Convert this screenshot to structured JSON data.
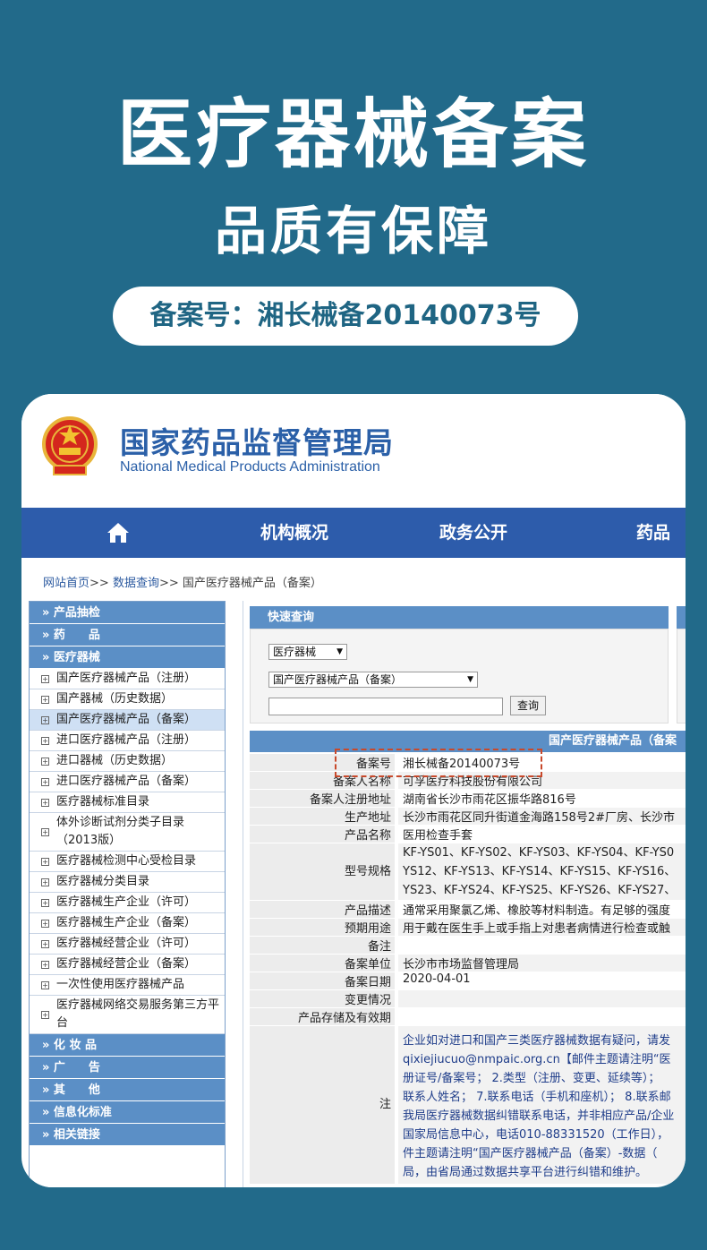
{
  "banner": {
    "title": "医疗器械备案",
    "subtitle": "品质有保障",
    "record_number": "备案号：湘长械备20140073号"
  },
  "site": {
    "org_cn": "国家药品监督管理局",
    "org_en": "National Medical Products Administration"
  },
  "nav": {
    "items": [
      "机构概况",
      "政务公开",
      "药品"
    ]
  },
  "breadcrumb": {
    "home": "网站首页",
    "sep": ">>",
    "query": "数据查询",
    "current": "国产医疗器械产品（备案）"
  },
  "sidebar": {
    "sections_top": [
      "» 产品抽检",
      "» 药　　品",
      "» 医疗器械"
    ],
    "items": [
      "国产医疗器械产品（注册）",
      "国产器械（历史数据）",
      "国产医疗器械产品（备案）",
      "进口医疗器械产品（注册）",
      "进口器械（历史数据）",
      "进口医疗器械产品（备案）",
      "医疗器械标准目录",
      "体外诊断试剂分类子目录（2013版）",
      "医疗器械检测中心受检目录",
      "医疗器械分类目录",
      "医疗器械生产企业（许可）",
      "医疗器械生产企业（备案）",
      "医疗器械经营企业（许可）",
      "医疗器械经营企业（备案）",
      "一次性使用医疗器械产品",
      "医疗器械网络交易服务第三方平台"
    ],
    "sections_bottom": [
      "» 化 妆 品",
      "» 广　　告",
      "» 其　　他",
      "» 信息化标准",
      "» 相关链接"
    ]
  },
  "quick_search": {
    "header": "快速查询",
    "select1": "医疗器械",
    "select2": "国产医疗器械产品（备案）",
    "button": "查询"
  },
  "result": {
    "header": "国产医疗器械产品（备案",
    "rows": [
      {
        "label": "备案号",
        "value": "湘长械备20140073号"
      },
      {
        "label": "备案人名称",
        "value": "可孚医疗科技股份有限公司"
      },
      {
        "label": "备案人注册地址",
        "value": "湖南省长沙市雨花区振华路816号"
      },
      {
        "label": "生产地址",
        "value": "长沙市雨花区同升街道金海路158号2#厂房、长沙市"
      },
      {
        "label": "产品名称",
        "value": "医用检查手套"
      },
      {
        "label": "型号规格",
        "value_lines": [
          "KF-YS01、KF-YS02、KF-YS03、KF-YS04、KF-YS0",
          "YS12、KF-YS13、KF-YS14、KF-YS15、KF-YS16、",
          "YS23、KF-YS24、KF-YS25、KF-YS26、KF-YS27、"
        ]
      },
      {
        "label": "产品描述",
        "value": "通常采用聚氯乙烯、橡胶等材料制造。有足够的强度"
      },
      {
        "label": "预期用途",
        "value": "用于戴在医生手上或手指上对患者病情进行检查或触"
      },
      {
        "label": "备注",
        "value": ""
      },
      {
        "label": "备案单位",
        "value": "长沙市市场监督管理局"
      },
      {
        "label": "备案日期",
        "value": "2020-04-01"
      },
      {
        "label": "变更情况",
        "value": ""
      },
      {
        "label": "产品存储及有效期",
        "value": ""
      }
    ],
    "note_label": "注",
    "note_lines": [
      "企业如对进口和国产三类医疗器械数据有疑问，请发",
      "qixiejiucuo@nmpaic.org.cn【邮件主题请注明“医",
      "册证号/备案号； 2.类型（注册、变更、延续等）；",
      "联系人姓名； 7.联系电话（手机和座机）； 8.联系邮",
      "我局医疗器械数据纠错联系电话，并非相应产品/企业",
      "国家局信息中心，电话010-88331520（工作日），",
      "件主题请注明“国产医疗器械产品（备案）-数据（",
      "局，由省局通过数据共享平台进行纠错和维护。"
    ]
  },
  "colors": {
    "background": "#226a8a",
    "nav_blue": "#2d5cab",
    "sidebar_blue": "#5b8fc6",
    "highlight_red": "#c8492b"
  }
}
